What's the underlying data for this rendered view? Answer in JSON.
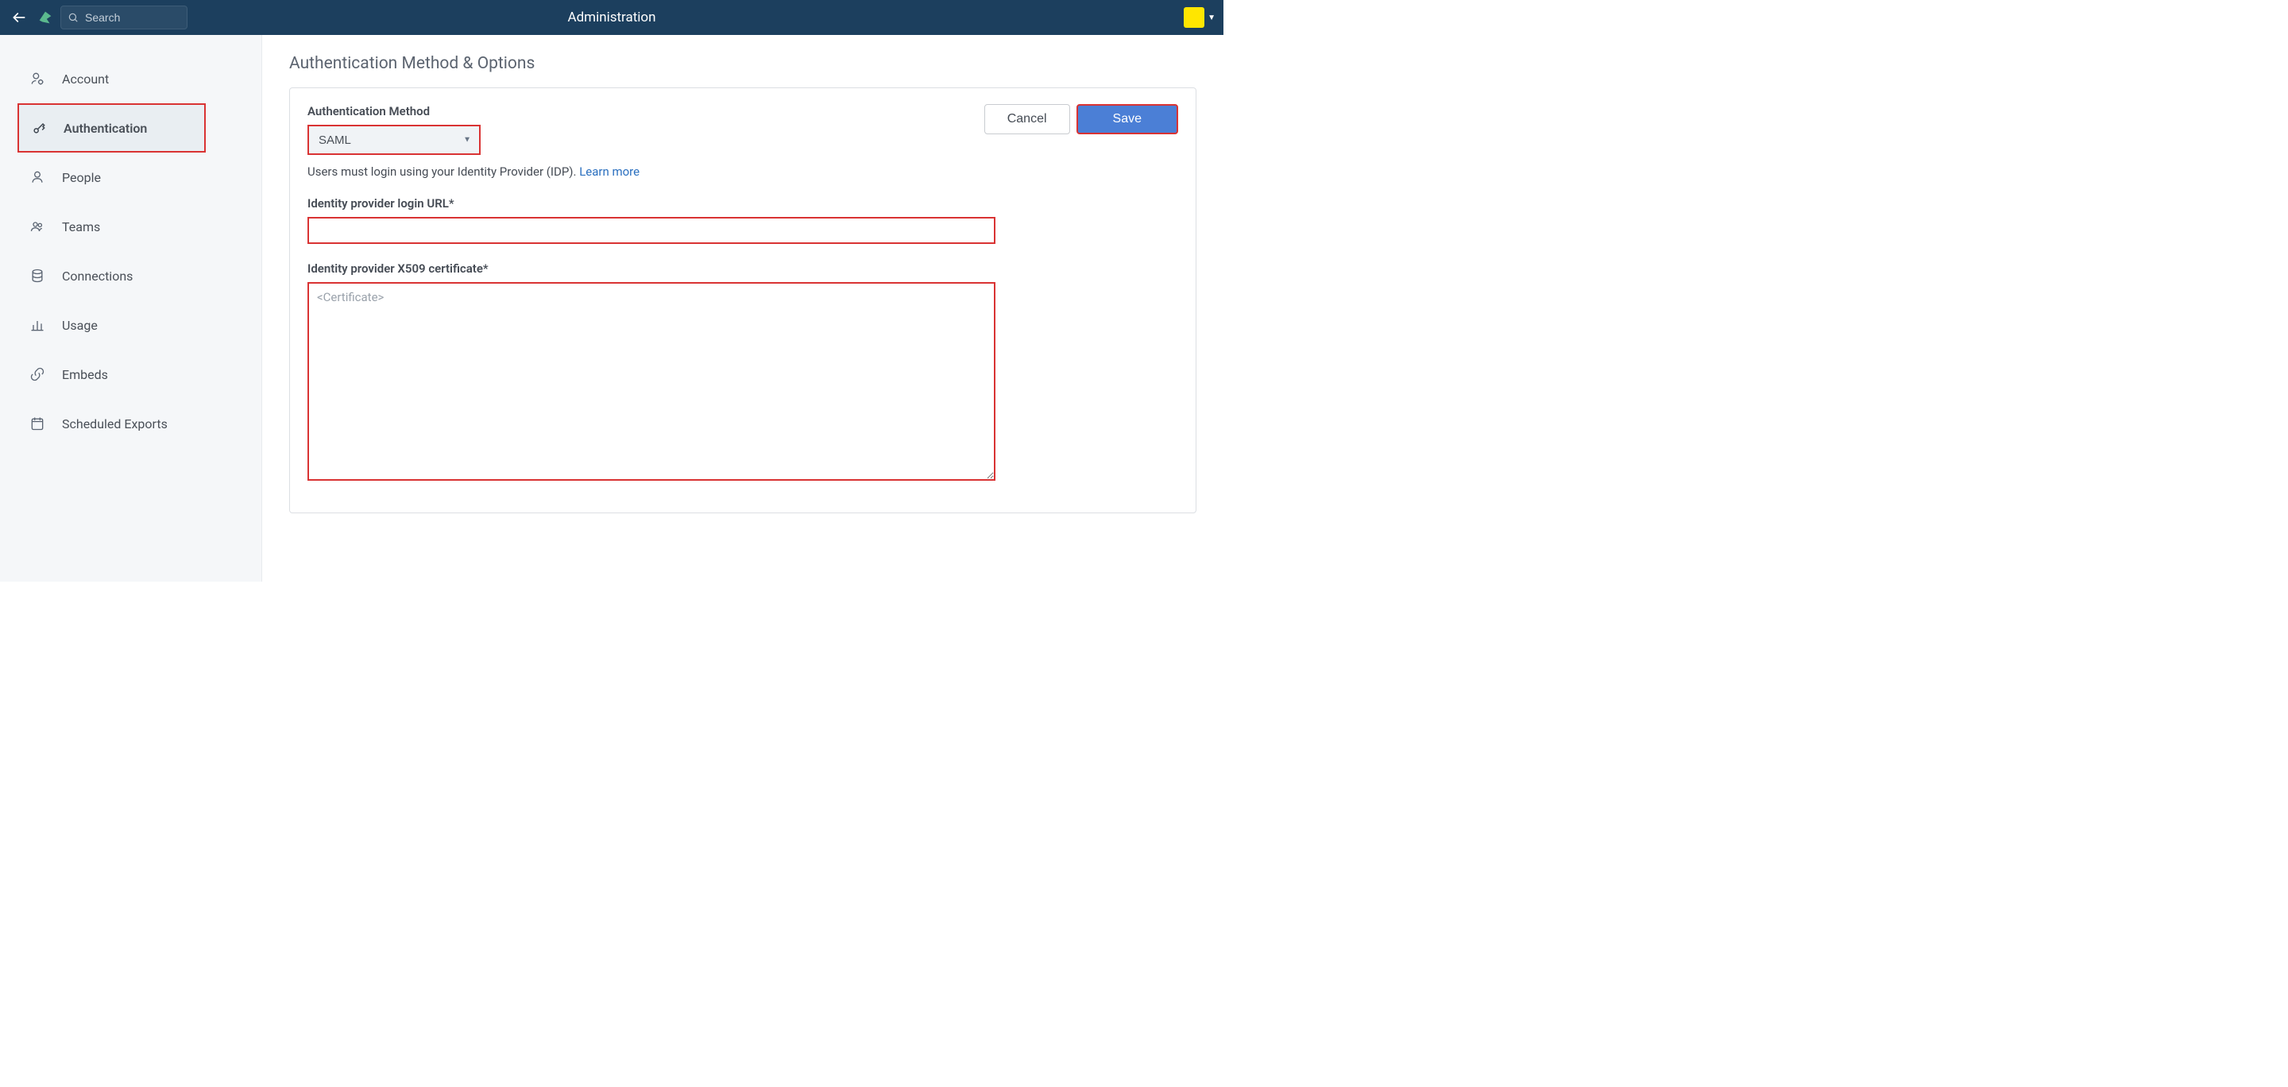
{
  "header": {
    "title": "Administration",
    "search_placeholder": "Search"
  },
  "sidebar": {
    "items": [
      {
        "key": "account",
        "label": "Account"
      },
      {
        "key": "authentication",
        "label": "Authentication",
        "active": true
      },
      {
        "key": "people",
        "label": "People"
      },
      {
        "key": "teams",
        "label": "Teams"
      },
      {
        "key": "connections",
        "label": "Connections"
      },
      {
        "key": "usage",
        "label": "Usage"
      },
      {
        "key": "embeds",
        "label": "Embeds"
      },
      {
        "key": "scheduled-exports",
        "label": "Scheduled Exports"
      }
    ]
  },
  "page": {
    "title": "Authentication Method & Options",
    "auth_method_label": "Authentication Method",
    "auth_method_value": "SAML",
    "hint_text": "Users must login using your Identity Provider (IDP). ",
    "learn_more": "Learn more",
    "idp_url_label": "Identity provider login URL*",
    "idp_url_value": "",
    "idp_cert_label": "Identity provider X509 certificate*",
    "idp_cert_placeholder": "<Certificate>",
    "idp_cert_value": "",
    "cancel_label": "Cancel",
    "save_label": "Save"
  },
  "colors": {
    "header_bg": "#1c3f5e",
    "highlight_border": "#d93333",
    "primary_button": "#4b7fd6",
    "avatar": "#ffe600",
    "sidebar_bg": "#f5f7f9",
    "link": "#2a6fbf"
  }
}
